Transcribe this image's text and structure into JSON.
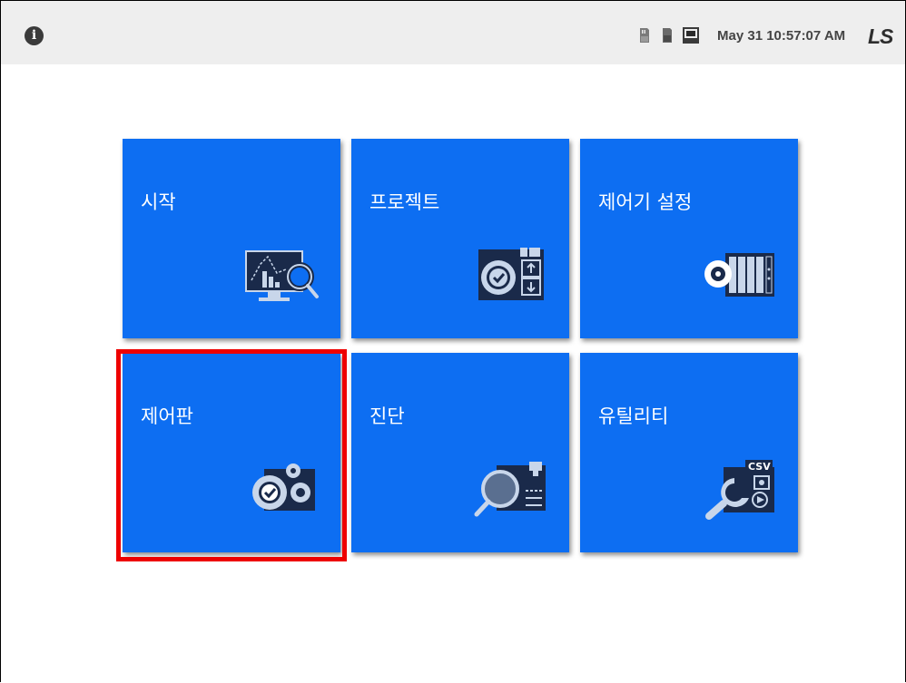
{
  "topbar": {
    "info_icon": "info-icon",
    "status_icons": [
      "sd-card-icon",
      "sd-card-icon",
      "ethernet-icon"
    ],
    "datetime": "May 31 10:57:07 AM",
    "logo_text": "LS"
  },
  "tiles": [
    {
      "label": "시작",
      "icon": "monitor-chart-search-icon"
    },
    {
      "label": "프로젝트",
      "icon": "project-gear-transfer-icon"
    },
    {
      "label": "제어기 설정",
      "icon": "controller-gear-icon"
    },
    {
      "label": "제어판",
      "icon": "gears-check-icon"
    },
    {
      "label": "진단",
      "icon": "diagnosis-magnifier-icon"
    },
    {
      "label": "유틸리티",
      "icon": "wrench-csv-icon"
    }
  ],
  "highlighted_tile": "제어판",
  "colors": {
    "tile": "#0d6ef2",
    "highlight": "#ee0000",
    "topbar": "#eeeeee",
    "icon_dark": "#1a2a4a",
    "icon_light": "#c8d6ea"
  }
}
